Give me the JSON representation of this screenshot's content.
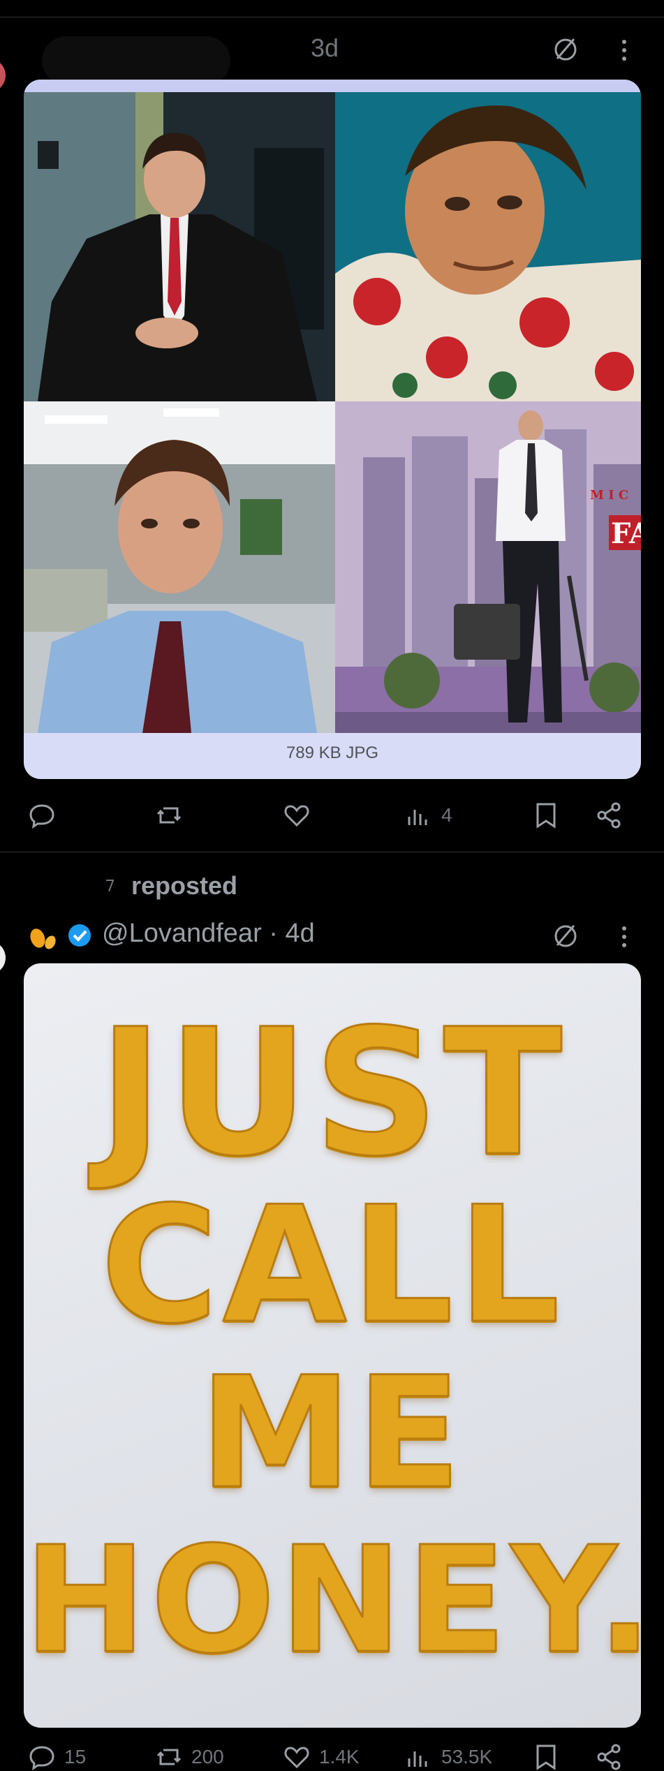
{
  "post1": {
    "author_hidden": "",
    "timestamp": "3d",
    "media": {
      "caption": "789 KB JPG",
      "tiles": [
        "business-suit-man-photo",
        "floral-shirt-man-photo",
        "office-worker-photo",
        "city-briefcase-poster"
      ],
      "poster_text_small": "M I C",
      "poster_text_large": "FA"
    },
    "actions": {
      "views": "4"
    }
  },
  "post2": {
    "repost_text": "reposted",
    "handle": "@Lovandfear",
    "timestamp": "· 4d",
    "image": {
      "lines": [
        "JUST",
        "CALL",
        "ME",
        "HONEY."
      ]
    },
    "actions": {
      "replies": "15",
      "reposts": "200",
      "likes": "1.4K",
      "views": "53.5K"
    }
  },
  "colors": {
    "background": "#000000",
    "text": "#e7e9ea",
    "muted": "#71767b",
    "verified": "#1d9bf0",
    "honey": "#e3a51e"
  },
  "icons": [
    "no-access-icon",
    "more-options-icon",
    "reply-icon",
    "repost-icon",
    "like-icon",
    "views-icon",
    "bookmark-icon",
    "share-icon",
    "verified-badge-icon"
  ]
}
